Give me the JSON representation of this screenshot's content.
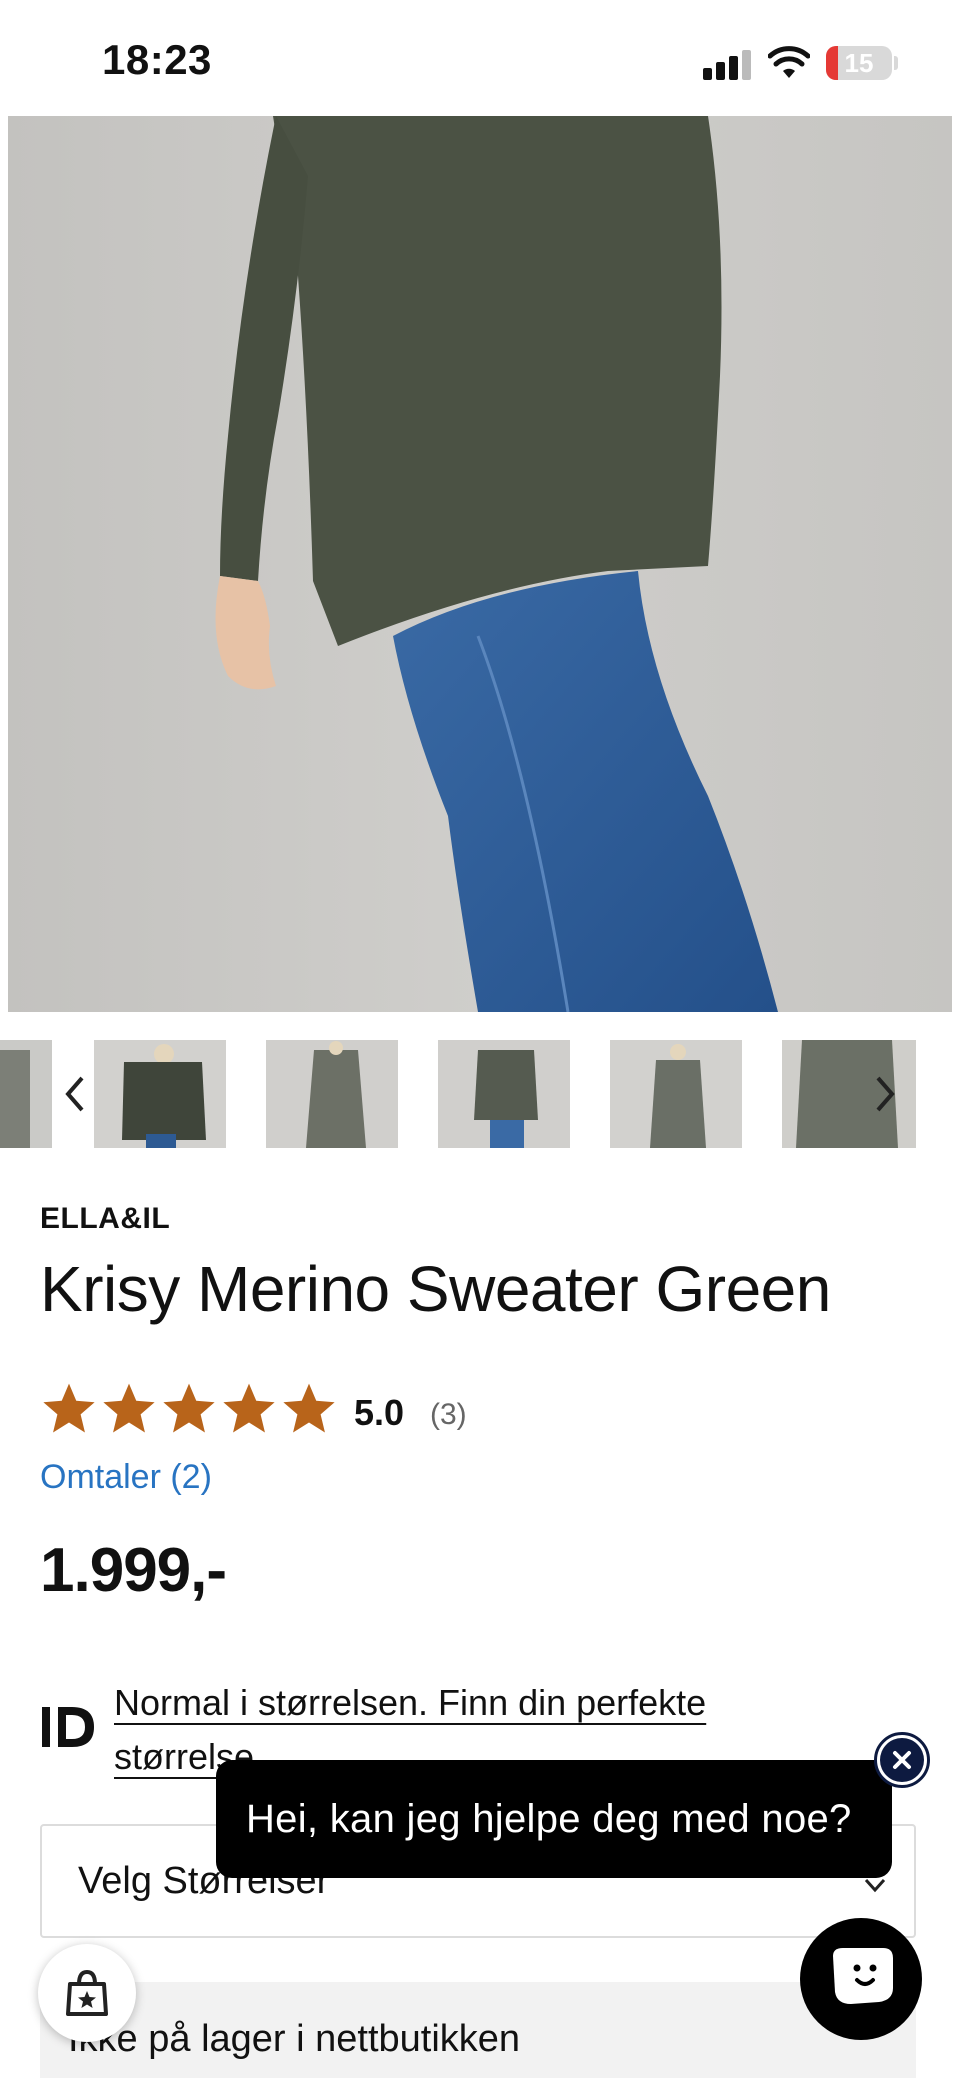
{
  "status_bar": {
    "time": "18:23",
    "battery_percent": "15",
    "icons": [
      "signal-icon",
      "wifi-icon",
      "battery-icon"
    ]
  },
  "product": {
    "brand": "ELLA&IL",
    "title": "Krisy Merino Sweater Green",
    "rating_value": "5.0",
    "rating_count": "(3)",
    "stars": 5,
    "reviews_link": "Omtaler (2)",
    "price": "1.999,-"
  },
  "gallery": {
    "thumbnail_count": 7,
    "prev_icon": "chevron-left-icon",
    "next_icon": "chevron-right-icon"
  },
  "fit_advice": {
    "logo_text": "ID",
    "text": "Normal i størrelsen. Finn din perfekte størrelse"
  },
  "size_select": {
    "label": "Velg Størrelser"
  },
  "stock": {
    "text": "Ikke på lager i nettbutikken"
  },
  "chat": {
    "bubble_text": "Hei, kan jeg hjelpe deg med noe?"
  },
  "colors": {
    "star": "#b8641a",
    "link": "#2874c2",
    "chat_bg": "#000000",
    "close_ring": "#0d1a40",
    "sweater": "#4b5244",
    "jeans": "#2d5a93"
  }
}
